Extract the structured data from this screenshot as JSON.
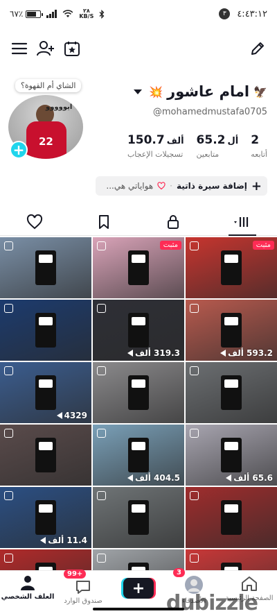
{
  "status_bar": {
    "time": "٤:٤٣:١٢",
    "notification_count": "٣",
    "battery": "٦٧٪",
    "speed_value": "٢٨",
    "speed_unit": "KB/S"
  },
  "profile": {
    "display_name": "امام عاشور",
    "username": "@mohamedmustafa0705",
    "bubble_text": "الشاي أم القهوة؟",
    "avatar_banner": "ايووووو",
    "avatar_shirt_number": "22"
  },
  "stats": [
    {
      "value": "2",
      "unit": "",
      "label": "أتابعه"
    },
    {
      "value": "65.2",
      "unit": "أل",
      "label": "متابعين"
    },
    {
      "value": "150.7",
      "unit": "ألف",
      "label": "تسجيلات الإعجاب"
    }
  ],
  "bio": {
    "add_label": "إضافة سيرة ذاتية",
    "interests_label": "هواياتي هي..."
  },
  "grid": {
    "pinned_label": "مثبت",
    "unit": "ألف",
    "tiles": [
      {
        "views": "",
        "pinned": false,
        "bg": "#7a8fa6"
      },
      {
        "views": "",
        "pinned": true,
        "bg": "#d9a3b8"
      },
      {
        "views": "",
        "pinned": true,
        "bg": "#c7352f"
      },
      {
        "views": "",
        "pinned": false,
        "bg": "#1c3b6e"
      },
      {
        "views": "319.3 ألف",
        "pinned": false,
        "bg": "#2e2f36"
      },
      {
        "views": "593.2 ألف",
        "pinned": false,
        "bg": "#b85a4e"
      },
      {
        "views": "4329",
        "pinned": false,
        "bg": "#3b5d8f"
      },
      {
        "views": "",
        "pinned": false,
        "bg": "#8b8a8c"
      },
      {
        "views": "",
        "pinned": false,
        "bg": "#6c6f72"
      },
      {
        "views": "",
        "pinned": false,
        "bg": "#5a4b4b"
      },
      {
        "views": "404.5 ألف",
        "pinned": false,
        "bg": "#7aa0b8"
      },
      {
        "views": "65.6 ألف",
        "pinned": false,
        "bg": "#a8a5b0"
      },
      {
        "views": "11.4 ألف",
        "pinned": false,
        "bg": "#2b4f83"
      },
      {
        "views": "",
        "pinned": false,
        "bg": "#6f7476"
      },
      {
        "views": "",
        "pinned": false,
        "bg": "#9f2d2d"
      },
      {
        "views": "",
        "pinned": false,
        "bg": "#b02a2a"
      },
      {
        "views": "",
        "pinned": false,
        "bg": "#a0a4a8"
      },
      {
        "views": "",
        "pinned": false,
        "bg": "#c93838"
      }
    ]
  },
  "bottom_nav": {
    "profile_label": "العلف الشخصي",
    "inbox_label": "صندوق الوارد",
    "inbox_badge": "99+",
    "friends_label": "الأصدقاء",
    "friends_badge": "3",
    "home_label": "الصفحة الرئيسية"
  },
  "watermark": {
    "text": "dubizzle"
  },
  "colors": {
    "accent_red": "#fe2c55",
    "accent_cyan": "#20d5ec",
    "text_primary": "#161823"
  }
}
